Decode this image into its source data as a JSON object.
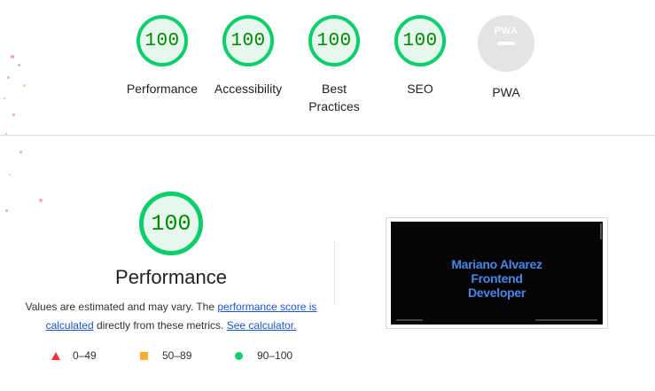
{
  "summary_gauges": [
    {
      "score": "100",
      "label": "Performance"
    },
    {
      "score": "100",
      "label": "Accessibility"
    },
    {
      "score": "100",
      "label": "Best\nPractices"
    },
    {
      "score": "100",
      "label": "SEO"
    }
  ],
  "pwa": {
    "badge_text": "PWA",
    "label": "PWA"
  },
  "performance": {
    "score": "100",
    "title": "Performance",
    "desc_prefix": "Values are estimated and may vary. The ",
    "desc_link1": "performance score is calculated",
    "desc_middle": " directly from these metrics. ",
    "desc_link2": "See calculator."
  },
  "legend": [
    {
      "range": "0–49",
      "color": "#ff3333"
    },
    {
      "range": "50–89",
      "color": "#ffaa33"
    },
    {
      "range": "90–100",
      "color": "#0cce6b"
    }
  ],
  "screenshot": {
    "heading_line1": "Mariano Alvarez",
    "heading_line2": "Frontend",
    "heading_line3": "Developer"
  },
  "colors": {
    "pass": "#0cce6b",
    "pass_bg": "#e6f8ee",
    "score_text": "#008800",
    "link": "#1a55d4"
  }
}
